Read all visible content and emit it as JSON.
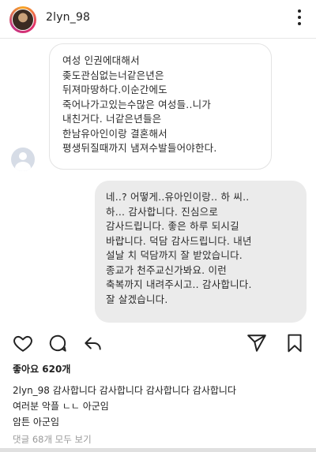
{
  "header": {
    "username": "2lyn_98",
    "more_icon": "more-vertical-icon"
  },
  "chat": {
    "received_message": "여성 인권에대해서\n좆도관심없는너같은년은\n뒤져마땅하다.이순간에도\n죽어나가고있는수많은 여성들..니가\n내친거다. 너같은년들은\n한남유아인이랑 결혼해서\n평생뒤질때까지 냄져수발들어야한다.",
    "sent_message": "네..? 어떻게..유아인이랑.. 하 씨..\n하... 감사합니다. 진심으로\n감사드립니다. 좋은 하루 되시길\n바랍니다. 덕담 감사드립니다. 내년\n설날 치 덕담까지 잘 받았습니다.\n종교가 천주교신가봐요. 이런\n축복까지 내려주시고.. 감사합니다.\n잘 살겠습니다."
  },
  "actions": {
    "icons": [
      "heart-icon",
      "comment-icon",
      "share-icon",
      "send-icon",
      "bookmark-icon"
    ]
  },
  "post": {
    "likes": "좋아요 620개",
    "caption_username": "2lyn_98",
    "caption_text": " 감사합니다 감사합니다 감사합니다 감사합니다",
    "caption_line2": "여러분 악플 ㄴㄴ 아군임",
    "caption_line3": "암튼 아군임",
    "comments_link": "댓글 68개 모두 보기"
  },
  "colors": {
    "sent_bubble": "#ebebeb",
    "received_bubble_border": "#e3e3e3",
    "muted_text": "#999999"
  }
}
